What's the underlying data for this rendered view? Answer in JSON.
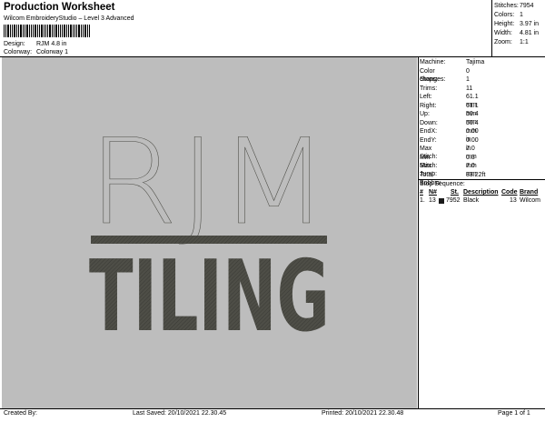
{
  "header": {
    "title": "Production Worksheet",
    "subtitle": "Wilcom EmbroideryStudio – Level 3 Advanced",
    "design_label": "Design:",
    "design_value": "RJM 4.8 in",
    "colorway_label": "Colorway:",
    "colorway_value": "Colorway 1"
  },
  "summary": {
    "stitches_label": "Stitches:",
    "stitches": "7954",
    "colors_label": "Colors:",
    "colors": "1",
    "height_label": "Height:",
    "height": "3.97 in",
    "width_label": "Width:",
    "width": "4.81 in",
    "zoom_label": "Zoom:",
    "zoom": "1:1"
  },
  "design": {
    "line1": "RJM",
    "line2": "TILING",
    "thread_color": "#4a4a44",
    "background_color": "#bdbdbd"
  },
  "machine_info": [
    {
      "label": "Machine:",
      "value": "Tajima"
    },
    {
      "label": "Color changes:",
      "value": "0"
    },
    {
      "label": "Stops:",
      "value": "1"
    },
    {
      "label": "Trims:",
      "value": "11"
    },
    {
      "label": "Left:",
      "value": "61.1 mm"
    },
    {
      "label": "Right:",
      "value": "61.1 mm"
    },
    {
      "label": "Up:",
      "value": "50.4 mm"
    },
    {
      "label": "Down:",
      "value": "50.4 mm"
    },
    {
      "label": "EndX:",
      "value": "0.00 in"
    },
    {
      "label": "EndY:",
      "value": "0.00 in"
    },
    {
      "label": "Max Stitch:",
      "value": "7.0 mm"
    },
    {
      "label": "Min Stitch:",
      "value": "0.3 mm"
    },
    {
      "label": "Max Jump:",
      "value": "7.0 mm"
    },
    {
      "label": "Total Bobbin:",
      "value": "83.22ft"
    }
  ],
  "stop_sequence": {
    "title": "Stop Sequence:",
    "columns": [
      "#",
      "N#",
      "St.",
      "Description",
      "Code",
      "Brand"
    ],
    "rows": [
      {
        "num": "1.",
        "needle": "13",
        "swatch": "#1a1a1a",
        "stitches": "7952",
        "description": "Black",
        "code": "13",
        "brand": "Wilcom"
      }
    ]
  },
  "footer": {
    "created_by": "Created By:",
    "last_saved": "Last Saved: 20/10/2021 22.30.45",
    "printed": "Printed: 20/10/2021 22.30.48",
    "page": "Page 1 of 1"
  }
}
